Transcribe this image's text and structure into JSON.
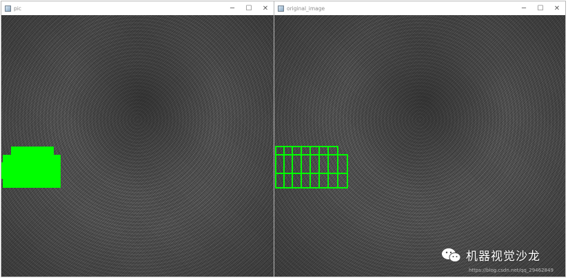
{
  "windows": {
    "left": {
      "title": "pic",
      "icon": "window-app-icon"
    },
    "right": {
      "title": "original_image",
      "icon": "window-app-icon"
    }
  },
  "controls": {
    "minimize": "─",
    "maximize": "☐",
    "close": "✕"
  },
  "colors": {
    "detection_green": "#00ff00",
    "background_gray": "#4a4a4a"
  },
  "watermark": {
    "brand": "机器视觉沙龙",
    "icon": "wechat-icon",
    "url": "https://blog.csdn.net/qq_29462849"
  }
}
